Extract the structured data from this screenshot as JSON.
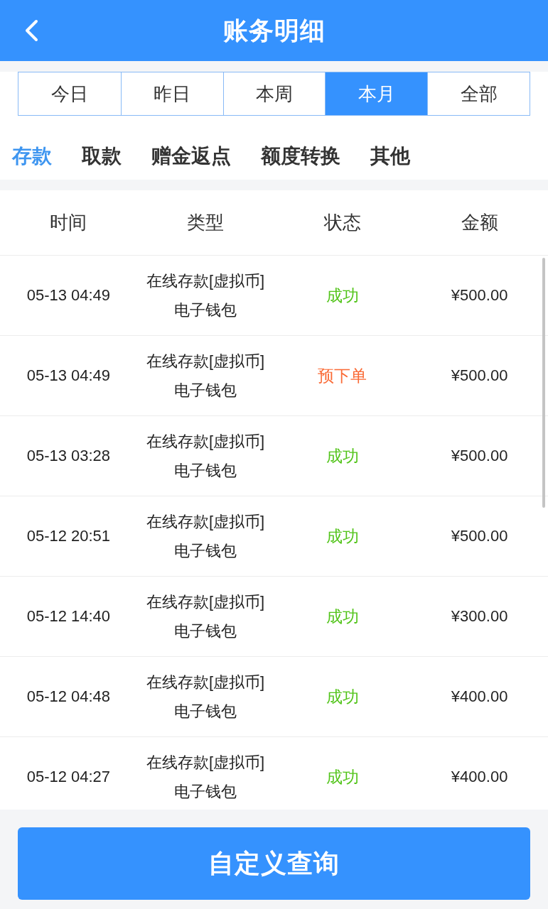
{
  "header": {
    "title": "账务明细"
  },
  "periods": [
    {
      "label": "今日",
      "selected": false
    },
    {
      "label": "昨日",
      "selected": false
    },
    {
      "label": "本周",
      "selected": false
    },
    {
      "label": "本月",
      "selected": true
    },
    {
      "label": "全部",
      "selected": false
    }
  ],
  "categories": [
    {
      "label": "存款",
      "selected": true
    },
    {
      "label": "取款",
      "selected": false
    },
    {
      "label": "赠金返点",
      "selected": false
    },
    {
      "label": "额度转换",
      "selected": false
    },
    {
      "label": "其他",
      "selected": false
    }
  ],
  "table": {
    "columns": [
      "时间",
      "类型",
      "状态",
      "金额"
    ],
    "rows": [
      {
        "time": "05-13 04:49",
        "type": [
          "在线存款[虚拟币]",
          "电子钱包"
        ],
        "status": {
          "label": "成功",
          "color": "#52c41a"
        },
        "amount": "¥500.00"
      },
      {
        "time": "05-13 04:49",
        "type": [
          "在线存款[虚拟币]",
          "电子钱包"
        ],
        "status": {
          "label": "预下单",
          "color": "#fa6a35"
        },
        "amount": "¥500.00"
      },
      {
        "time": "05-13 03:28",
        "type": [
          "在线存款[虚拟币]",
          "电子钱包"
        ],
        "status": {
          "label": "成功",
          "color": "#52c41a"
        },
        "amount": "¥500.00"
      },
      {
        "time": "05-12 20:51",
        "type": [
          "在线存款[虚拟币]",
          "电子钱包"
        ],
        "status": {
          "label": "成功",
          "color": "#52c41a"
        },
        "amount": "¥500.00"
      },
      {
        "time": "05-12 14:40",
        "type": [
          "在线存款[虚拟币]",
          "电子钱包"
        ],
        "status": {
          "label": "成功",
          "color": "#52c41a"
        },
        "amount": "¥300.00"
      },
      {
        "time": "05-12 04:48",
        "type": [
          "在线存款[虚拟币]",
          "电子钱包"
        ],
        "status": {
          "label": "成功",
          "color": "#52c41a"
        },
        "amount": "¥400.00"
      },
      {
        "time": "05-12 04:27",
        "type": [
          "在线存款[虚拟币]",
          "电子钱包"
        ],
        "status": {
          "label": "成功",
          "color": "#52c41a"
        },
        "amount": "¥400.00"
      }
    ]
  },
  "query_button": "自定义查询"
}
